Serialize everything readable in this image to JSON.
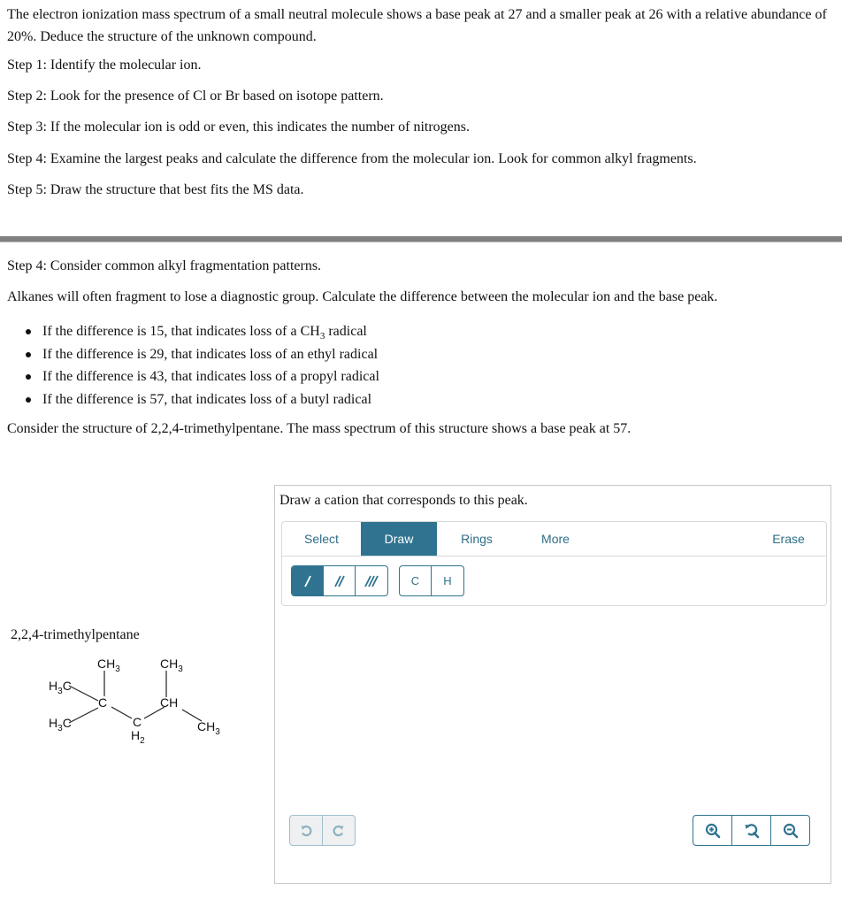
{
  "question": {
    "text": "The electron ionization mass spectrum of a small neutral molecule shows a base peak at 27 and a smaller peak at 26 with a relative abundance of 20%. Deduce the structure of the unknown compound.",
    "steps": [
      "Step 1: Identify the molecular ion.",
      "Step 2: Look for the presence of Cl or Br based on isotope pattern.",
      "Step 3: If the molecular ion is odd or even, this indicates the number of nitrogens.",
      "Step 4: Examine the largest peaks and calculate the difference from the molecular ion. Look for common alkyl fragments.",
      "Step 5: Draw the structure that best fits the MS data."
    ]
  },
  "hint": {
    "heading": "Step 4: Consider common alkyl fragmentation patterns.",
    "intro": "Alkanes will often fragment to lose a diagnostic group. Calculate the difference between the molecular ion and the base peak.",
    "bullets": [
      {
        "pre": "If the difference is 15, that indicates loss of a CH",
        "sub": "3",
        "post": " radical"
      },
      {
        "pre": "If the difference is 29, that indicates loss of an ethyl radical",
        "sub": "",
        "post": ""
      },
      {
        "pre": "If the difference is 43, that indicates loss of a propyl radical",
        "sub": "",
        "post": ""
      },
      {
        "pre": "If the difference is 57, that indicates loss of a butyl radical",
        "sub": "",
        "post": ""
      }
    ],
    "consider": "Consider the structure of 2,2,4-trimethylpentane. The mass spectrum of this structure shows a base peak at 57."
  },
  "molecule": {
    "name": "2,2,4-trimethylpentane",
    "labels": {
      "ch3": "CH",
      "h3c": "H",
      "c": "C",
      "ch": "CH",
      "h2": "H",
      "three": "3",
      "two": "2",
      "c_suffix": "C"
    }
  },
  "widget": {
    "prompt": "Draw a cation that corresponds to this peak.",
    "tabs": [
      "Select",
      "Draw",
      "Rings",
      "More",
      "Erase"
    ],
    "active_tab": "Draw",
    "atom_buttons": [
      "C",
      "H"
    ],
    "bond_buttons": [
      "single-bond",
      "double-bond",
      "triple-bond"
    ],
    "active_bond": "single-bond",
    "accent_color": "#2f7390"
  }
}
